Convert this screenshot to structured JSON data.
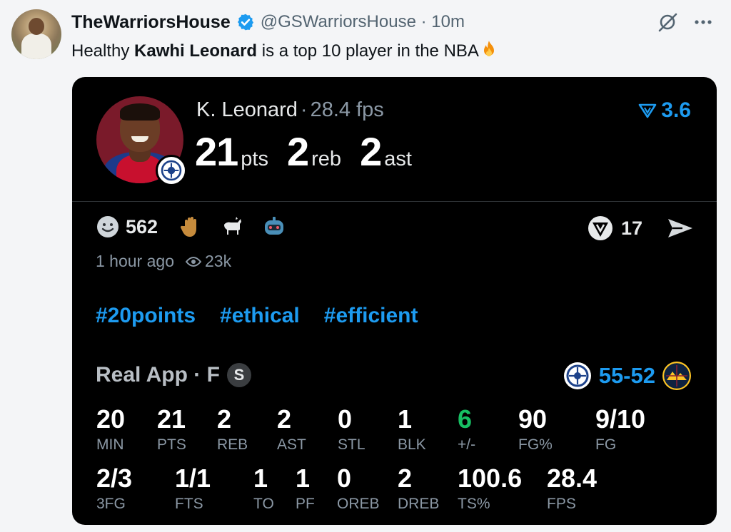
{
  "tweet": {
    "display_name": "TheWarriorsHouse",
    "handle": "@GSWarriorsHouse · 10m",
    "text_before": "Healthy ",
    "text_bold": "Kawhi Leonard",
    "text_after": " is a top 10 player in the NBA"
  },
  "card": {
    "player_name": "K. Leonard",
    "fps_label": "28.4 fps",
    "headline": {
      "pts": "21",
      "pts_unit": "pts",
      "reb": "2",
      "reb_unit": "reb",
      "ast": "2",
      "ast_unit": "ast"
    },
    "rating": "3.6",
    "reactions": {
      "count": "562",
      "right_count": "17"
    },
    "time_ago": "1 hour ago",
    "views": "23k",
    "hashtags": [
      "#20points",
      "#ethical",
      "#efficient"
    ],
    "game_label": "Real App · F",
    "game_badge": "S",
    "score": "55-52",
    "stats_row1": [
      {
        "value": "20",
        "label": "MIN"
      },
      {
        "value": "21",
        "label": "PTS"
      },
      {
        "value": "2",
        "label": "REB"
      },
      {
        "value": "2",
        "label": "AST"
      },
      {
        "value": "0",
        "label": "STL"
      },
      {
        "value": "1",
        "label": "BLK"
      },
      {
        "value": "6",
        "label": "+/-"
      },
      {
        "value": "90",
        "label": "FG%"
      },
      {
        "value": "9/10",
        "label": "FG"
      }
    ],
    "stats_row2": [
      {
        "value": "2/3",
        "label": "3FG"
      },
      {
        "value": "1/1",
        "label": "FTS"
      },
      {
        "value": "1",
        "label": "TO"
      },
      {
        "value": "1",
        "label": "PF"
      },
      {
        "value": "0",
        "label": "OREB"
      },
      {
        "value": "2",
        "label": "DREB"
      },
      {
        "value": "100.6",
        "label": "TS%"
      },
      {
        "value": "28.4",
        "label": "FPS"
      }
    ]
  },
  "colors": {
    "accent": "#1d9bf0",
    "positive": "#17bf63",
    "card_bg": "#000000",
    "page_bg": "#f4f5f7"
  },
  "icons": [
    "verified-icon",
    "grok-icon",
    "more-icon",
    "fire-emoji",
    "smiley-icon",
    "raised-hand-emoji",
    "goat-emoji",
    "robot-emoji",
    "rating-icon",
    "eye-icon",
    "send-icon"
  ]
}
